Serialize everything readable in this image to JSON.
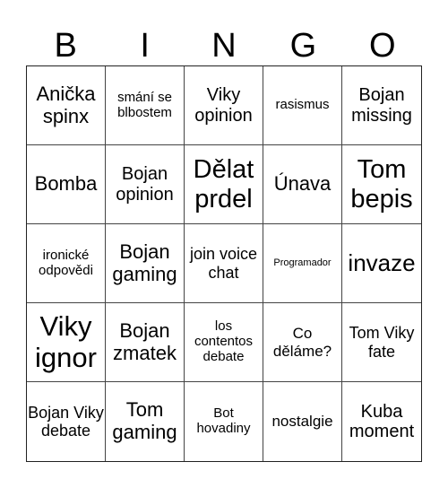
{
  "header": [
    "B",
    "I",
    "N",
    "G",
    "O"
  ],
  "cells": [
    "Anička spinx",
    "smání se blbostem",
    "Viky opinion",
    "rasismus",
    "Bojan missing",
    "Bomba",
    "Bojan opinion",
    "Dělat prdel",
    "Únava",
    "Tom bepis",
    "ironické odpovědi",
    "Bojan gaming",
    "join voice chat",
    "Programador",
    "invaze",
    "Viky ignor",
    "Bojan zmatek",
    "los contentos debate",
    "Co děláme?",
    "Tom Viky fate",
    "Bojan Viky debate",
    "Tom gaming",
    "Bot hovadiny",
    "nostalgie",
    "Kuba moment"
  ]
}
